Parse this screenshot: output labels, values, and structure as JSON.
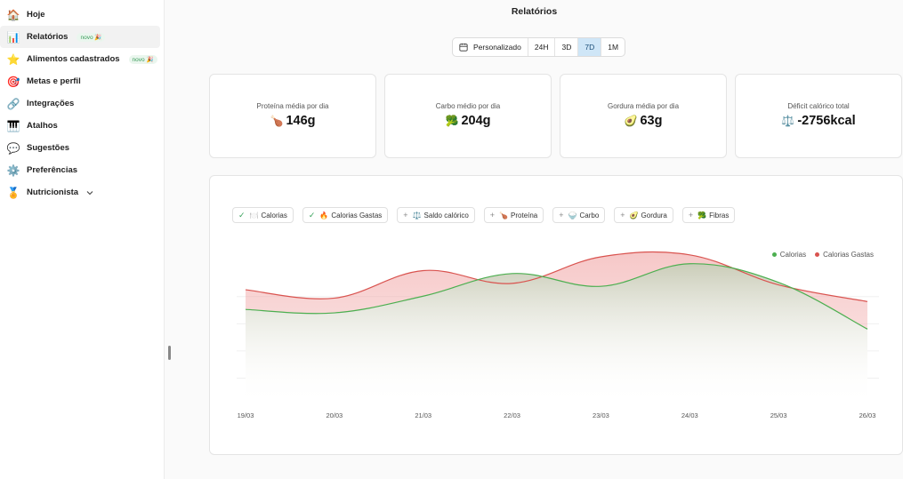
{
  "sidebar": {
    "items": [
      {
        "label": "Hoje",
        "icon": "🏠",
        "icon_name": "house-icon",
        "active": false,
        "badge": ""
      },
      {
        "label": "Relatórios",
        "icon": "📊",
        "icon_name": "bar-chart-icon",
        "active": true,
        "badge": "novo 🎉"
      },
      {
        "label": "Alimentos cadastrados",
        "icon": "⭐",
        "icon_name": "star-icon",
        "active": false,
        "badge": "novo 🎉"
      },
      {
        "label": "Metas e perfil",
        "icon": "🎯",
        "icon_name": "target-icon",
        "active": false,
        "badge": ""
      },
      {
        "label": "Integrações",
        "icon": "🔗",
        "icon_name": "link-icon",
        "active": false,
        "badge": ""
      },
      {
        "label": "Atalhos",
        "icon": "🎹",
        "icon_name": "keyboard-icon",
        "active": false,
        "badge": ""
      },
      {
        "label": "Sugestões",
        "icon": "💬",
        "icon_name": "chat-icon",
        "active": false,
        "badge": ""
      },
      {
        "label": "Preferências",
        "icon": "⚙️",
        "icon_name": "gear-icon",
        "active": false,
        "badge": ""
      },
      {
        "label": "Nutricionista",
        "icon": "🏅",
        "icon_name": "medal-icon",
        "active": false,
        "badge": "",
        "chevron": true
      }
    ]
  },
  "main": {
    "title": "Relatórios",
    "range": {
      "custom_label": "Personalizado",
      "options": [
        "24H",
        "3D",
        "7D",
        "1M"
      ],
      "selected": "7D"
    },
    "cards": [
      {
        "label": "Proteína média por dia",
        "icon": "🍗",
        "value": "146g"
      },
      {
        "label": "Carbo médio por dia",
        "icon": "🥦",
        "value": "204g"
      },
      {
        "label": "Gordura média por dia",
        "icon": "🥑",
        "value": "63g"
      },
      {
        "label": "Déficit calórico total",
        "icon": "⚖️",
        "value": "-2756kcal"
      }
    ],
    "chips": [
      {
        "label": "Calorias",
        "icon": "🍽️",
        "selected": true
      },
      {
        "label": "Calorias Gastas",
        "icon": "🔥",
        "selected": true
      },
      {
        "label": "Saldo calórico",
        "icon": "⚖️",
        "selected": false
      },
      {
        "label": "Proteína",
        "icon": "🍗",
        "selected": false
      },
      {
        "label": "Carbo",
        "icon": "🍚",
        "selected": false
      },
      {
        "label": "Gordura",
        "icon": "🥑",
        "selected": false
      },
      {
        "label": "Fibras",
        "icon": "🥦",
        "selected": false
      }
    ]
  },
  "colors": {
    "calorias": "#4caf50",
    "calorias_gastas": "#d9534f",
    "accent": "#cfe6f7"
  },
  "chart_data": {
    "type": "area",
    "x": [
      "19/03",
      "20/03",
      "21/03",
      "22/03",
      "23/03",
      "24/03",
      "25/03",
      "26/03"
    ],
    "series": [
      {
        "name": "Calorias",
        "values": [
          1950,
          1880,
          2220,
          2680,
          2420,
          2880,
          2500,
          1550
        ]
      },
      {
        "name": "Calorias Gastas",
        "values": [
          2350,
          2180,
          2740,
          2480,
          3020,
          3060,
          2450,
          2110
        ]
      }
    ],
    "ylim": [
      0,
      3400
    ],
    "grid": true,
    "legend": "top-right"
  }
}
